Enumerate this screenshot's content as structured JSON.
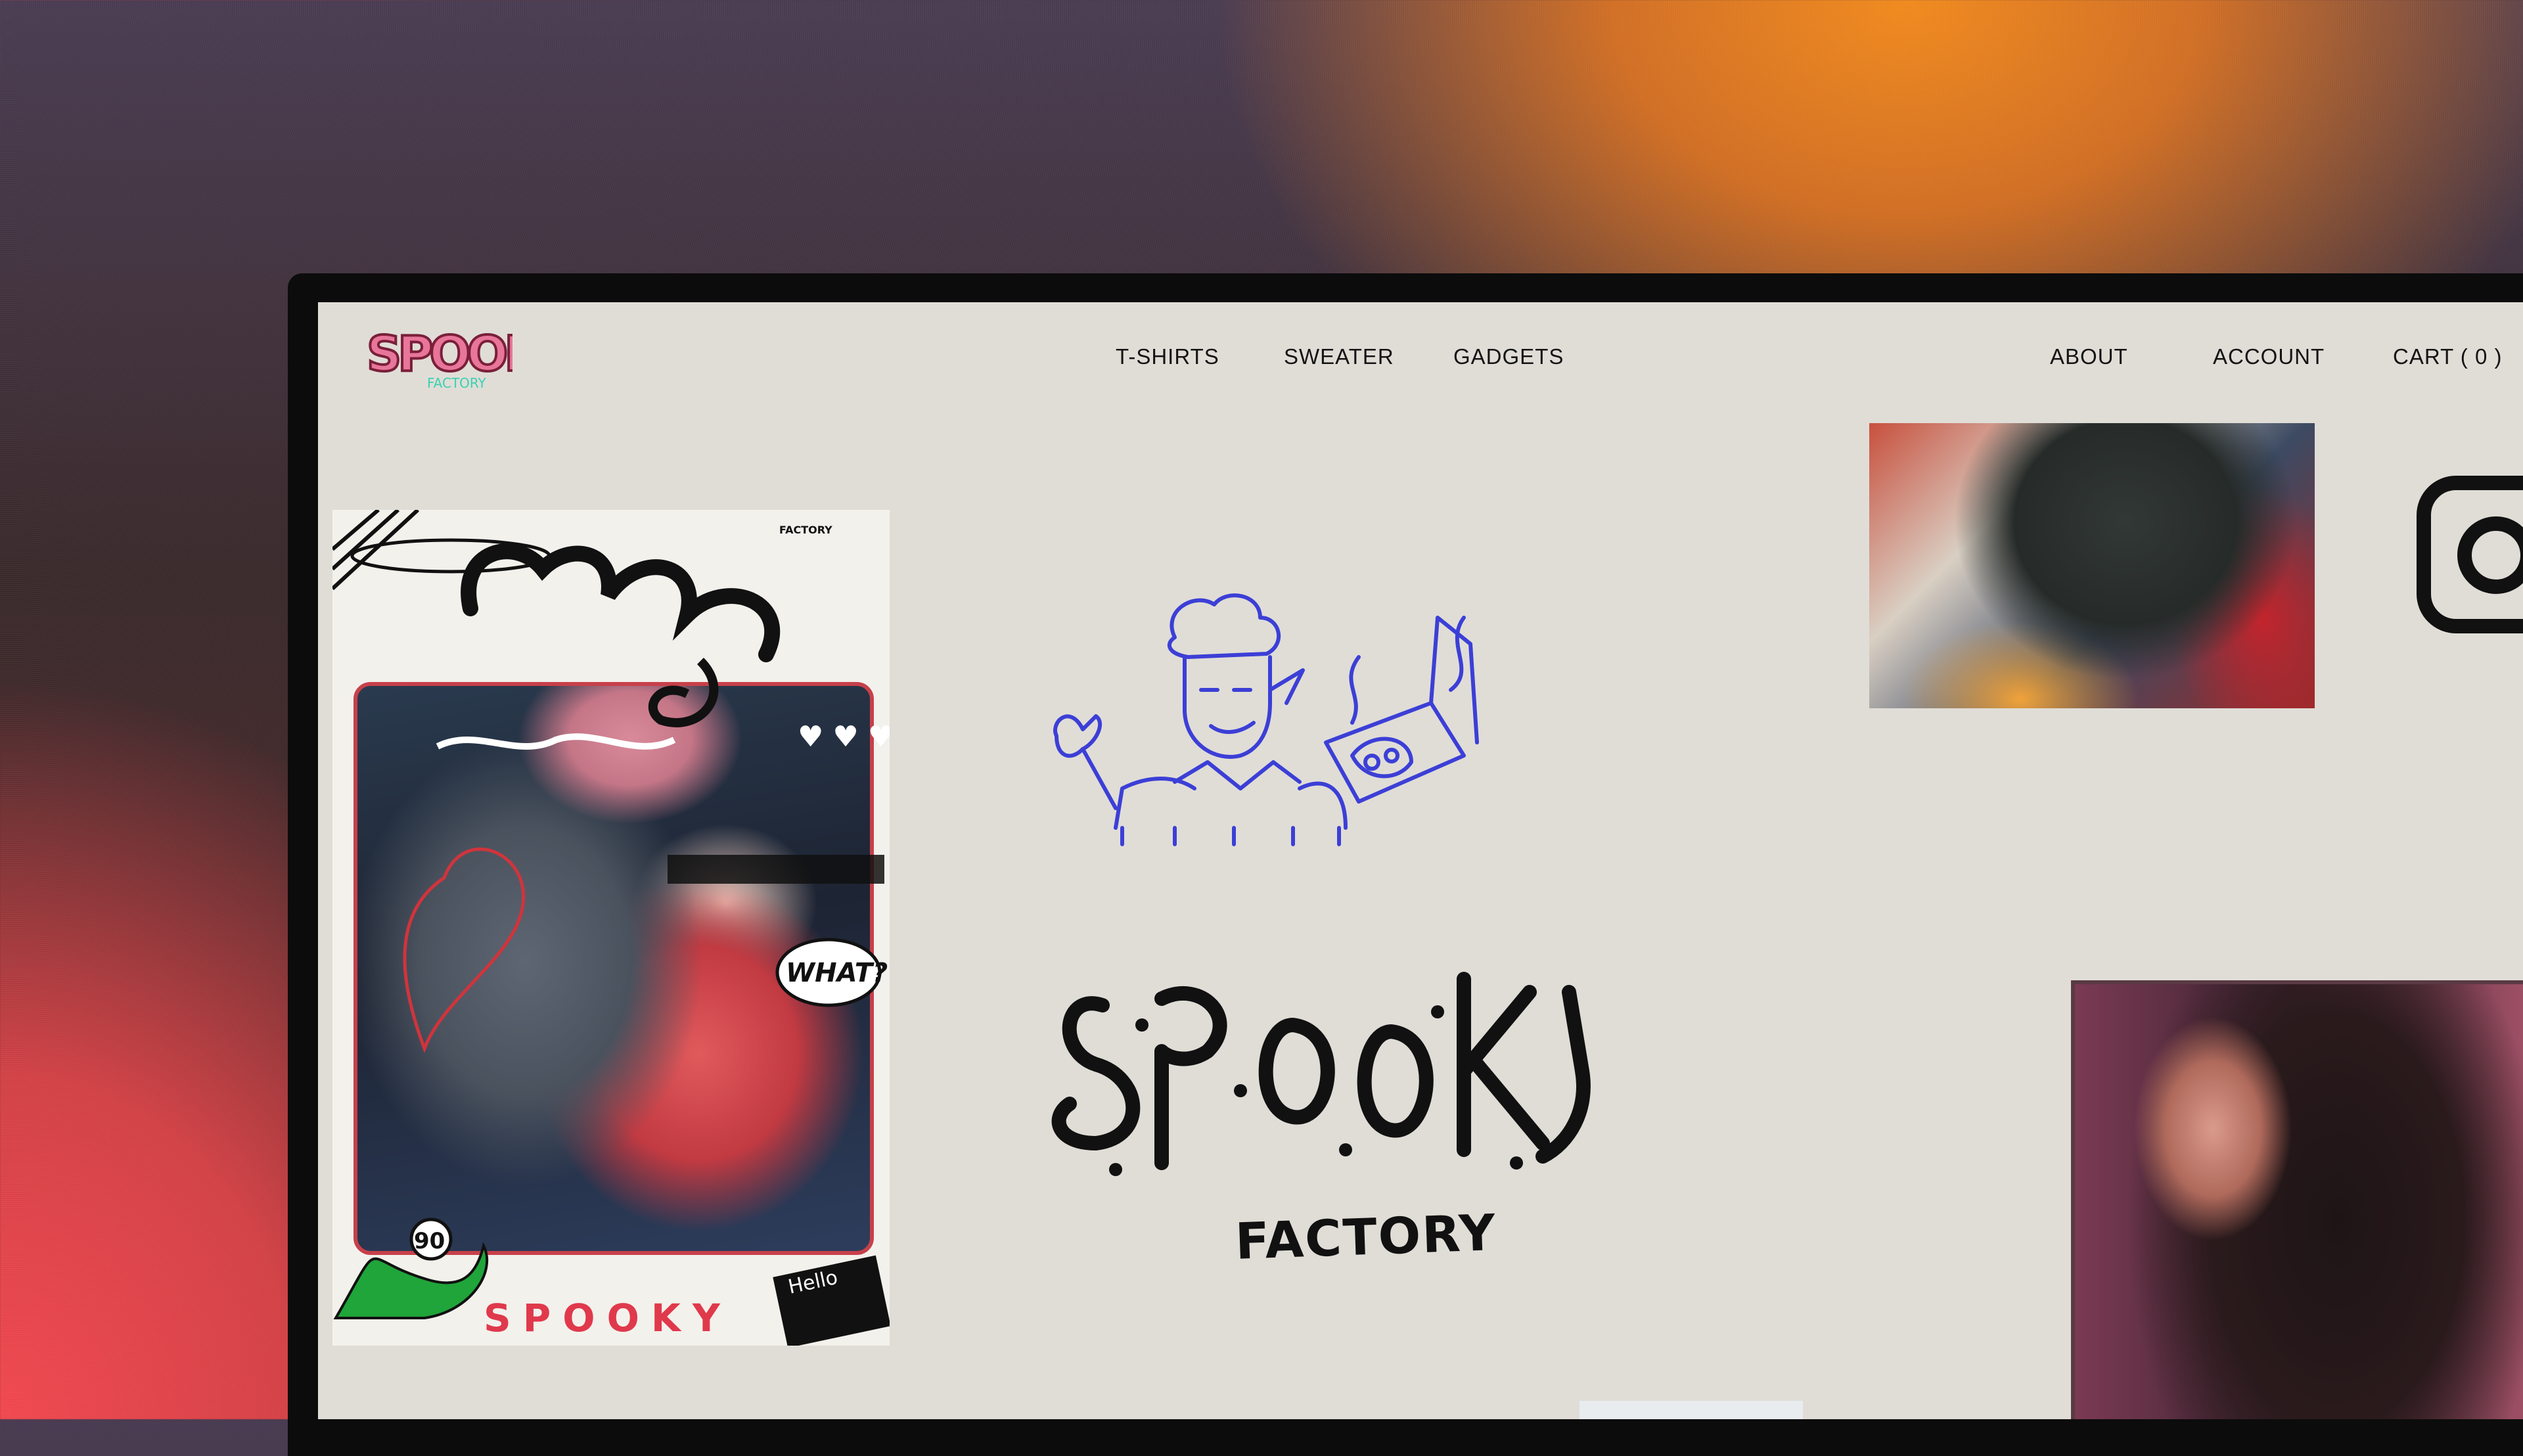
{
  "brand": {
    "name": "SPOOKY",
    "sub": "FACTORY",
    "accent_pink": "#e8769a",
    "accent_teal": "#3bd1b2",
    "accent_blue": "#3c3fd6"
  },
  "nav": {
    "left": [
      {
        "label": "T-SHIRTS"
      },
      {
        "label": "SWEATER"
      },
      {
        "label": "GADGETS"
      }
    ],
    "about": "ABOUT",
    "account": "ACCOUNT",
    "cart": "CART ( 0 )"
  },
  "hero": {
    "card_label": "SPOOKY",
    "sticker_text": "WHAT?",
    "hello_text": "Hello",
    "badge_number": "90",
    "factory_tag": "FACTORY"
  },
  "icons": {
    "social": "instagram-icon",
    "illustration": "chef-pizza-illustration"
  }
}
